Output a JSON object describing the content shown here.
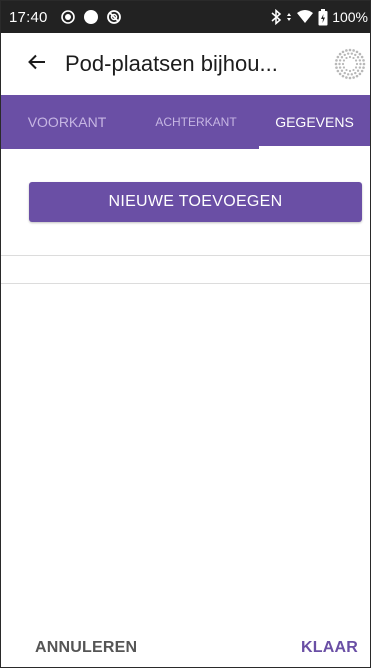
{
  "status_bar": {
    "time": "17:40",
    "battery": "100%",
    "icons": [
      "record-icon",
      "dot-icon",
      "blocked-icon",
      "bluetooth-icon",
      "signal-arrows-icon",
      "wifi-icon",
      "battery-icon"
    ]
  },
  "app_bar": {
    "title": "Pod-plaatsen bijhou...",
    "back_icon": "arrow-left-icon",
    "spinner_icon": "spinner-icon"
  },
  "tabs": [
    {
      "label": "VOORKANT",
      "active": false
    },
    {
      "label": "ACHTERKANT",
      "active": false
    },
    {
      "label": "GEGEVENS",
      "active": true
    }
  ],
  "main": {
    "add_button_label": "NIEUWE TOEVOEGEN"
  },
  "footer": {
    "cancel_label": "ANNULEREN",
    "done_label": "KLAAR"
  },
  "colors": {
    "accent": "#6a4fa5",
    "status_bar": "#222222",
    "inactive_tab": "#c6b6e3"
  }
}
